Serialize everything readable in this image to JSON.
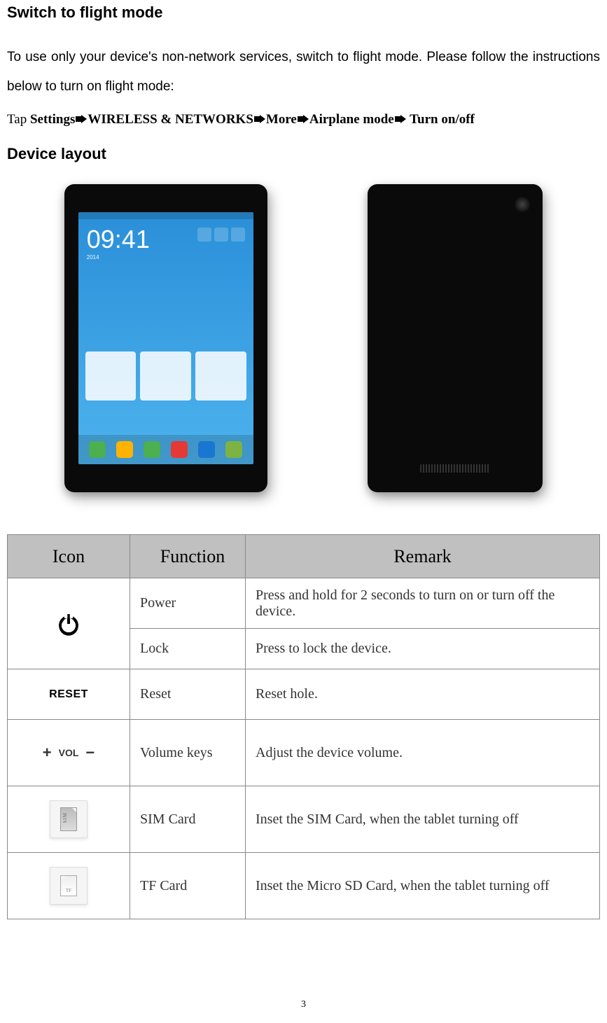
{
  "headings": {
    "flight_mode": "Switch to flight mode",
    "device_layout": "Device layout"
  },
  "paragraphs": {
    "flight_intro": "To use only your device's non-network services, switch to flight mode. Please follow the instructions below to turn on flight mode:"
  },
  "instruction": {
    "tap": "Tap ",
    "step1": "Settings",
    "step2": "WIRELESS & NETWORKS",
    "step3": "More",
    "step4": "Airplane mode",
    "step5": " Turn on/off"
  },
  "device_screen": {
    "time": "09:41",
    "date_prefix": "2014"
  },
  "table": {
    "headers": {
      "icon": "Icon",
      "function": "Function",
      "remark": "Remark"
    },
    "rows": [
      {
        "icon_name": "power",
        "function": "Power",
        "remark": "Press and hold for 2 seconds to turn on or turn off the device."
      },
      {
        "icon_name": "power",
        "function": "Lock",
        "remark": "Press to lock the device."
      },
      {
        "icon_name": "reset",
        "icon_text": "RESET",
        "function": "Reset",
        "remark": "Reset hole."
      },
      {
        "icon_name": "volume",
        "icon_text": "VOL",
        "function": "Volume keys",
        "remark": "Adjust the device volume."
      },
      {
        "icon_name": "sim",
        "function": "SIM Card",
        "remark": "Inset the SIM Card, when the tablet turning off"
      },
      {
        "icon_name": "tf",
        "function": "TF Card",
        "remark": "Inset the Micro SD Card, when the tablet turning off"
      }
    ]
  },
  "page_number": "3"
}
